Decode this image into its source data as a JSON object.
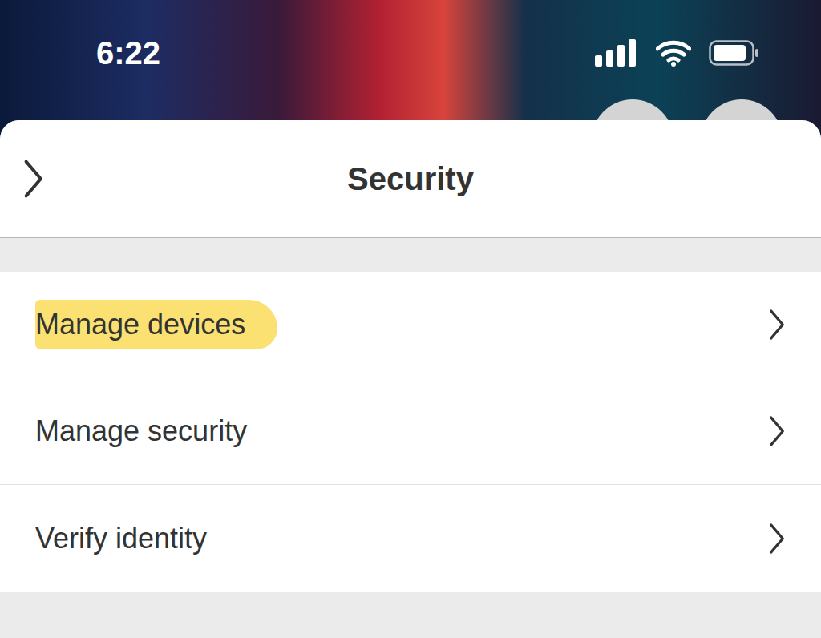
{
  "status_bar": {
    "time": "6:22"
  },
  "header": {
    "title": "Security"
  },
  "items": [
    {
      "label": "Manage devices",
      "highlighted": true
    },
    {
      "label": "Manage security",
      "highlighted": false
    },
    {
      "label": "Verify identity",
      "highlighted": false
    }
  ]
}
